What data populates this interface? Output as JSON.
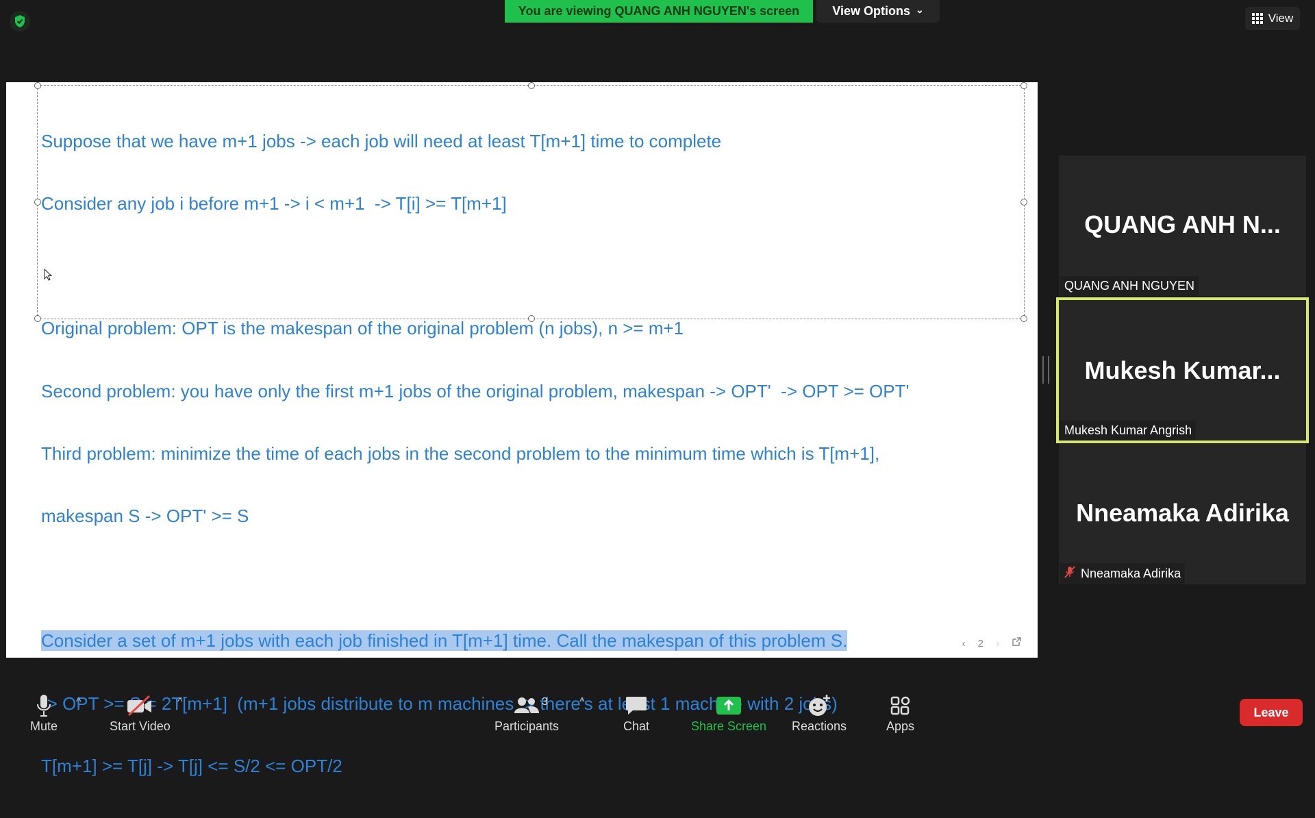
{
  "banner": {
    "text": "You are viewing QUANG ANH NGUYEN's screen"
  },
  "view_options": {
    "label": "View Options",
    "chevron": "⌄"
  },
  "view_button": {
    "label": "View"
  },
  "document": {
    "lines": [
      "Suppose that we have m+1 jobs -> each job will need at least T[m+1] time to complete",
      "Consider any job i before m+1 -> i < m+1  -> T[i] >= T[m+1]",
      "",
      "Original problem: OPT is the makespan of the original problem (n jobs), n >= m+1",
      "Second problem: you have only the first m+1 jobs of the original problem, makespan -> OPT'  -> OPT >= OPT'",
      "Third problem: minimize the time of each jobs in the second problem to the minimum time which is T[m+1],",
      "makespan S -> OPT' >= S",
      "",
      "Consider a set of m+1 jobs with each job finished in T[m+1] time. Call the makespan of this problem S.",
      "-> OPT >= S = 2T[m+1]  (m+1 jobs distribute to m machines -> there's at least 1 machine with 2 jobs)",
      "T[m+1] >= T[j] -> T[j] <= S/2 <= OPT/2"
    ],
    "highlighted_line_index": 8,
    "page_number": "2",
    "text_color": "#2e82d6",
    "highlight_color": "#a9c9ee"
  },
  "participants": [
    {
      "display_name": "QUANG ANH N...",
      "label": "QUANG ANH NGUYEN",
      "muted": false,
      "active": false
    },
    {
      "display_name": "Mukesh  Kumar...",
      "label": "Mukesh Kumar Angrish",
      "muted": false,
      "active": true
    },
    {
      "display_name": "Nneamaka Adirika",
      "label": "Nneamaka Adirika",
      "muted": true,
      "active": false
    }
  ],
  "toolbar": {
    "mute": "Mute",
    "start_video": "Start Video",
    "participants": "Participants",
    "participants_count": "3",
    "chat": "Chat",
    "share_screen": "Share Screen",
    "reactions": "Reactions",
    "apps": "Apps",
    "leave": "Leave",
    "caret": "^"
  },
  "colors": {
    "share_green": "#1fc04b",
    "leave_red": "#d92b2b",
    "active_border": "#d6e96a",
    "background": "#1a1a1a"
  }
}
